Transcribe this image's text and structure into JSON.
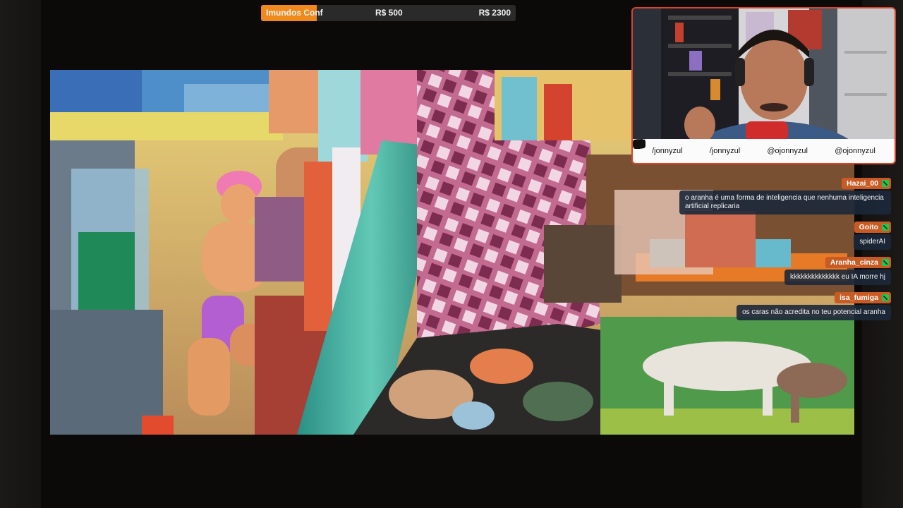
{
  "goal": {
    "name": "Imundos Conf",
    "current": "R$ 500",
    "target": "R$ 2300",
    "progress": 0.22,
    "accent_color": "#f08a1c"
  },
  "video": {
    "description_icon": "video-frame"
  },
  "webcam": {
    "border_color": "#d8442a",
    "socials": [
      {
        "icon": "youtube-icon",
        "handle": "/jonnyzul"
      },
      {
        "icon": "facebook-icon",
        "handle": "/jonnyzul"
      },
      {
        "icon": "twitter-icon",
        "handle": "@ojonnyzul"
      },
      {
        "icon": "instagram-icon",
        "handle": "@ojonnyzul"
      }
    ]
  },
  "chat": {
    "nick_color": "#c85a24",
    "messages": [
      {
        "user": "Hazai_00",
        "text": "o aranha é uma forma de inteligencia que nenhuma inteligencia artificial replicaria"
      },
      {
        "user": "Goito",
        "text": "spiderAI"
      },
      {
        "user": "Aranha_cinza",
        "text": "kkkkkkkkkkkkkk eu IA morre hj"
      },
      {
        "user": "isa_fumiga",
        "text": "os caras não acredita no teu potencial aranha"
      }
    ]
  }
}
